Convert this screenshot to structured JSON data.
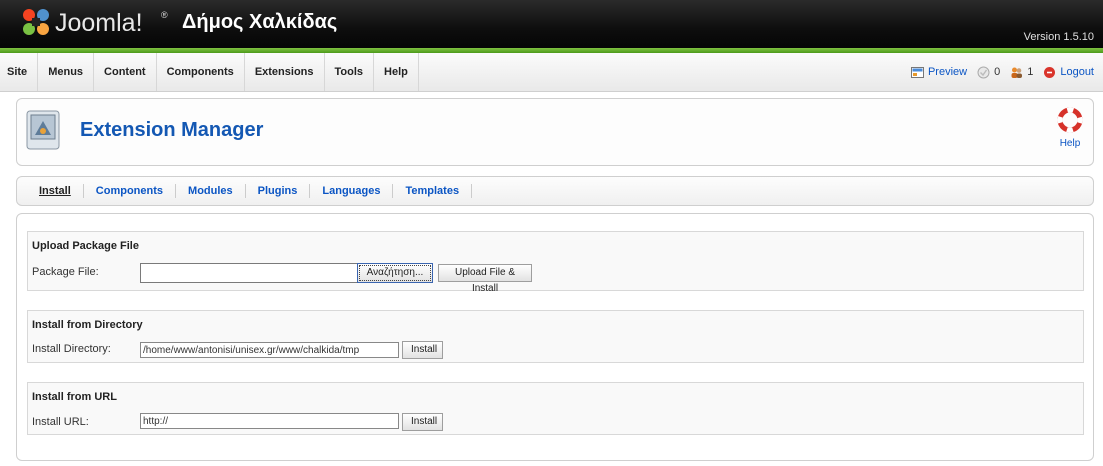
{
  "header": {
    "logo_text": "Joomla!",
    "logo_tm": "®",
    "site_name": "Δήμος Χαλκίδας",
    "version": "Version 1.5.10"
  },
  "menu": {
    "items": [
      {
        "label": "Site"
      },
      {
        "label": "Menus"
      },
      {
        "label": "Content"
      },
      {
        "label": "Components"
      },
      {
        "label": "Extensions"
      },
      {
        "label": "Tools"
      },
      {
        "label": "Help"
      }
    ]
  },
  "status": {
    "preview_label": "Preview",
    "messages_count": "0",
    "users_count": "1",
    "logout_label": "Logout"
  },
  "toolbar": {
    "title": "Extension Manager",
    "help_label": "Help"
  },
  "submenu": {
    "items": [
      {
        "label": "Install",
        "active": true
      },
      {
        "label": "Components"
      },
      {
        "label": "Modules"
      },
      {
        "label": "Plugins"
      },
      {
        "label": "Languages"
      },
      {
        "label": "Templates"
      }
    ]
  },
  "upload": {
    "title": "Upload Package File",
    "label": "Package File:",
    "value": "",
    "browse_label": "Αναζήτηση...",
    "button_label": "Upload File & Install"
  },
  "directory": {
    "title": "Install from Directory",
    "label": "Install Directory:",
    "value": "/home/www/antonisi/unisex.gr/www/chalkida/tmp",
    "button_label": "Install"
  },
  "url": {
    "title": "Install from URL",
    "label": "Install URL:",
    "value": "http://",
    "button_label": "Install"
  },
  "colors": {
    "header_bg": "#0e0e0e",
    "accent_green": "#6ab42d",
    "link_blue": "#0b55c4",
    "title_blue": "#1458b3"
  }
}
